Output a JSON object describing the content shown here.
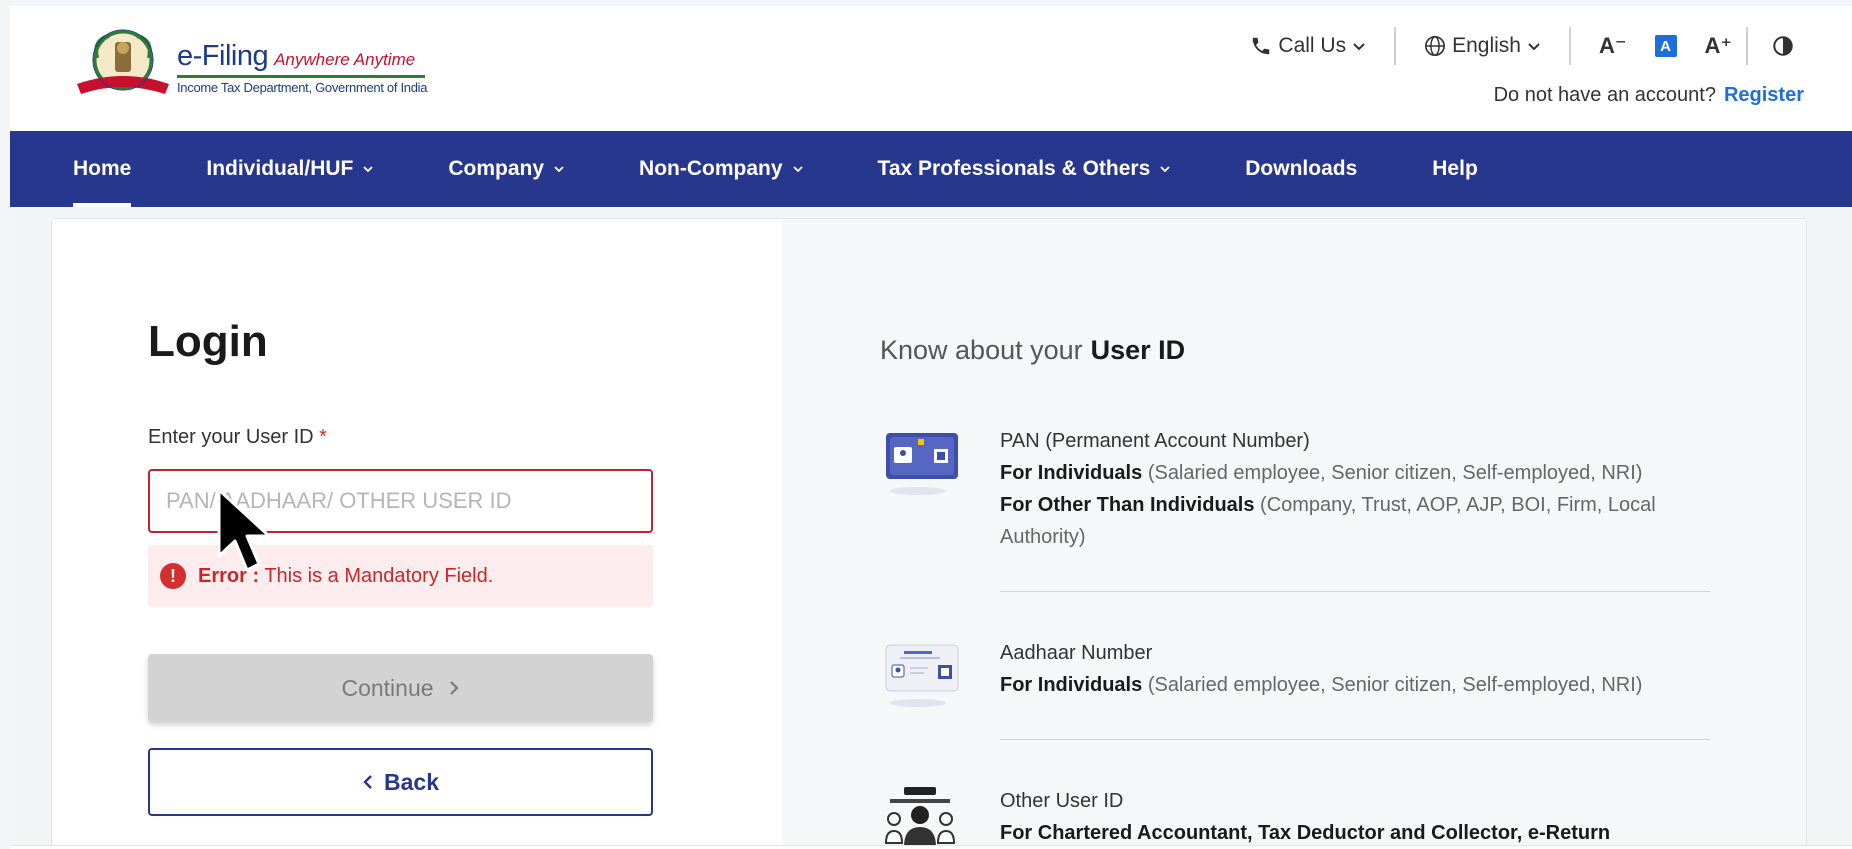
{
  "header": {
    "logo_title": "e-Filing",
    "logo_tagline": "Anywhere Anytime",
    "logo_subtitle": "Income Tax Department, Government of India",
    "call_us": "Call Us",
    "language": "English",
    "font_decrease": "A⁻",
    "font_normal": "A",
    "font_increase": "A⁺",
    "account_prompt": "Do not have an account?",
    "register_link": "Register"
  },
  "nav": {
    "items": [
      {
        "label": "Home"
      },
      {
        "label": "Individual/HUF"
      },
      {
        "label": "Company"
      },
      {
        "label": "Non-Company"
      },
      {
        "label": "Tax Professionals & Others"
      },
      {
        "label": "Downloads"
      },
      {
        "label": "Help"
      }
    ]
  },
  "login": {
    "title": "Login",
    "field_label": "Enter your User ID",
    "required_mark": "*",
    "placeholder": "PAN/ AADHAAR/ OTHER USER ID",
    "error_label": "Error :",
    "error_message": "This is a Mandatory Field.",
    "continue_label": "Continue",
    "back_label": "Back"
  },
  "info": {
    "title_prefix": "Know about your",
    "title_strong": "User ID",
    "items": [
      {
        "heading": "PAN (Permanent Account Number)",
        "line1_bold": "For Individuals",
        "line1_rest": "(Salaried employee, Senior citizen, Self-employed, NRI)",
        "line2_bold": "For Other Than Individuals",
        "line2_rest": "(Company, Trust, AOP, AJP, BOI, Firm, Local Authority)"
      },
      {
        "heading": "Aadhaar Number",
        "line1_bold": "For Individuals",
        "line1_rest": "(Salaried employee, Senior citizen, Self-employed, NRI)"
      },
      {
        "heading": "Other User ID",
        "line1_bold": "For Chartered Accountant, Tax Deductor and Collector, e-Return"
      }
    ]
  },
  "colors": {
    "nav_bg": "#28378e",
    "accent": "#1e6fd9",
    "error": "#c8202f"
  }
}
